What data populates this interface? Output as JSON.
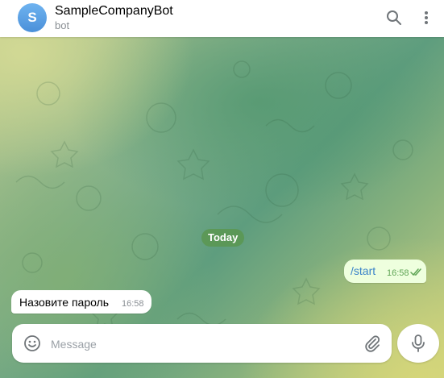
{
  "header": {
    "avatar_letter": "S",
    "title": "SampleCompanyBot",
    "subtitle": "bot",
    "icons": [
      "search-icon",
      "more-vertical-icon"
    ]
  },
  "date_separator": "Today",
  "messages": [
    {
      "direction": "outgoing",
      "text": "/start",
      "time": "16:58",
      "status": "read"
    },
    {
      "direction": "incoming",
      "text": "Назовите пароль",
      "time": "16:58"
    }
  ],
  "composer": {
    "placeholder": "Message",
    "value": "",
    "icons": [
      "emoji-icon",
      "paperclip-icon",
      "microphone-icon"
    ]
  },
  "colors": {
    "accent": "#4a90d9",
    "outgoing_bubble": "#eeffde",
    "date_pill": "#5a9650"
  }
}
